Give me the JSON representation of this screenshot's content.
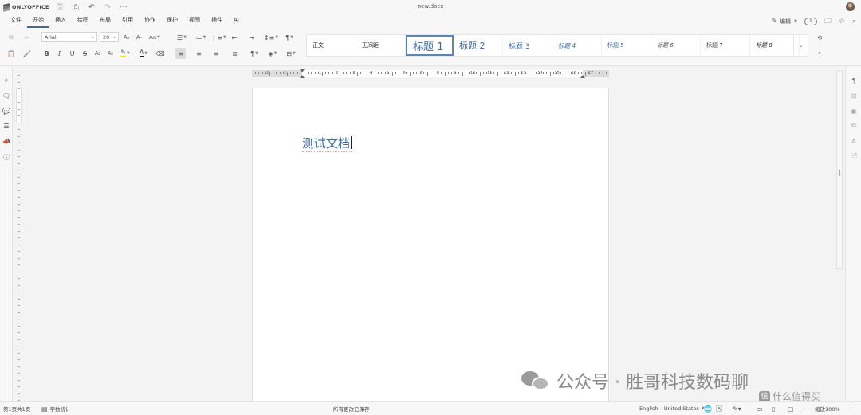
{
  "app": {
    "brand": "ONLYOFFICE",
    "document_title": "new.docx"
  },
  "quick_access": [
    {
      "name": "save-icon",
      "glyph": "🖫",
      "dim": true
    },
    {
      "name": "print-icon",
      "glyph": "⎙",
      "dim": false
    },
    {
      "name": "undo-icon",
      "glyph": "↶",
      "dim": false
    },
    {
      "name": "redo-icon",
      "glyph": "↷",
      "dim": true
    },
    {
      "name": "more-icon",
      "glyph": "···",
      "dim": false
    }
  ],
  "menu": {
    "items": [
      "文件",
      "开始",
      "插入",
      "绘图",
      "布局",
      "引用",
      "协作",
      "保护",
      "视图",
      "插件",
      "AI"
    ],
    "active": "开始",
    "edit_label": "编辑",
    "user_badge": "1"
  },
  "toolbar": {
    "font_name": "Arial",
    "font_size": "20",
    "styles": [
      "正文",
      "无间距",
      "标题 1",
      "标题 2",
      "标题 3",
      "标题 4",
      "标题 5",
      "标题 6",
      "标题 7",
      "标题 8"
    ]
  },
  "ruler": {
    "numbers": [
      "2",
      "1",
      "1",
      "2",
      "3",
      "4",
      "5",
      "6",
      "7",
      "8",
      "9",
      "10",
      "11",
      "12",
      "13",
      "14",
      "15",
      "16",
      "17"
    ]
  },
  "document": {
    "text": "测试文档"
  },
  "watermark": {
    "main": "公众号 · 胜哥科技数码聊",
    "secondary": "什么值得买",
    "badge": "值"
  },
  "status": {
    "page_info": "第1页共1页",
    "word_count": "字数统计",
    "save_state": "所有更改已保存",
    "language": "English – United States",
    "zoom": "缩放100%"
  }
}
